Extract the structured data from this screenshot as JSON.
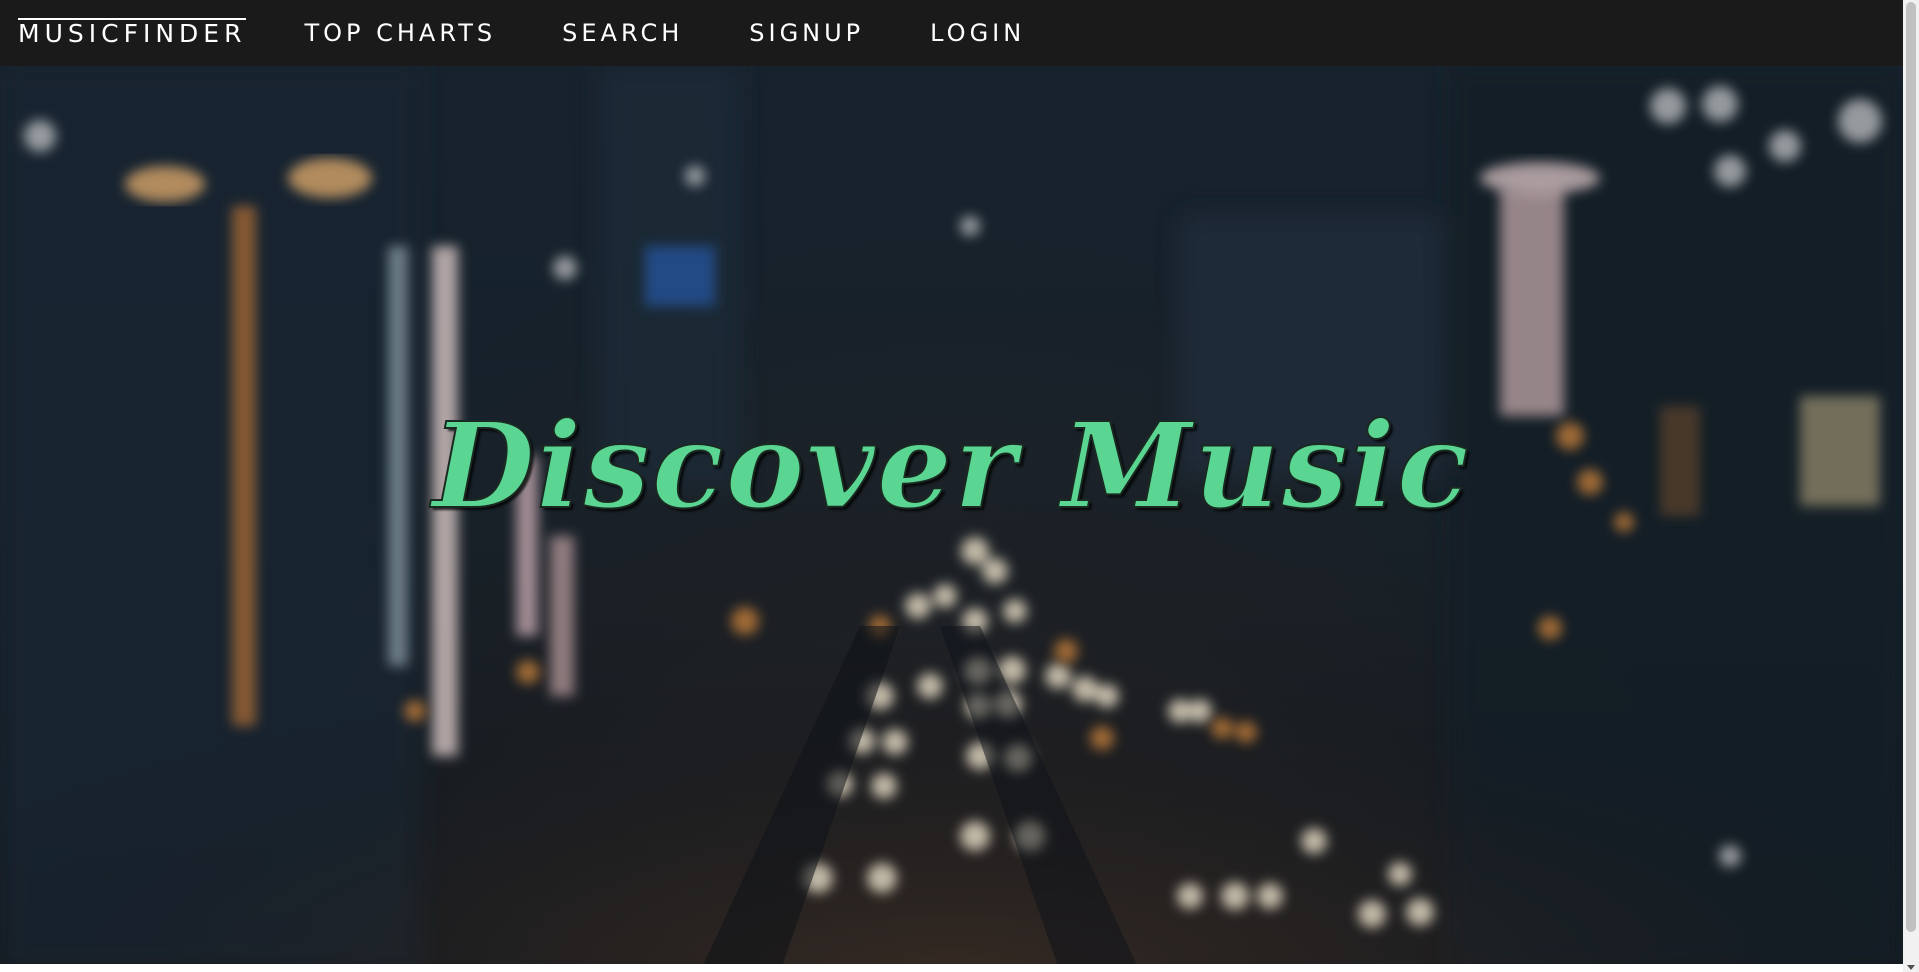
{
  "navbar": {
    "brand": "MUSICFINDER",
    "links": [
      {
        "label": "TOP CHARTS"
      },
      {
        "label": "SEARCH"
      },
      {
        "label": "SIGNUP"
      },
      {
        "label": "LOGIN"
      }
    ]
  },
  "hero": {
    "title": "Discover Music",
    "background_image": "blurred-city-night-traffic-photo"
  },
  "colors": {
    "navbar_bg": "#1a1a1a",
    "nav_text": "#ffffff",
    "title_accent": "#5bd592"
  }
}
